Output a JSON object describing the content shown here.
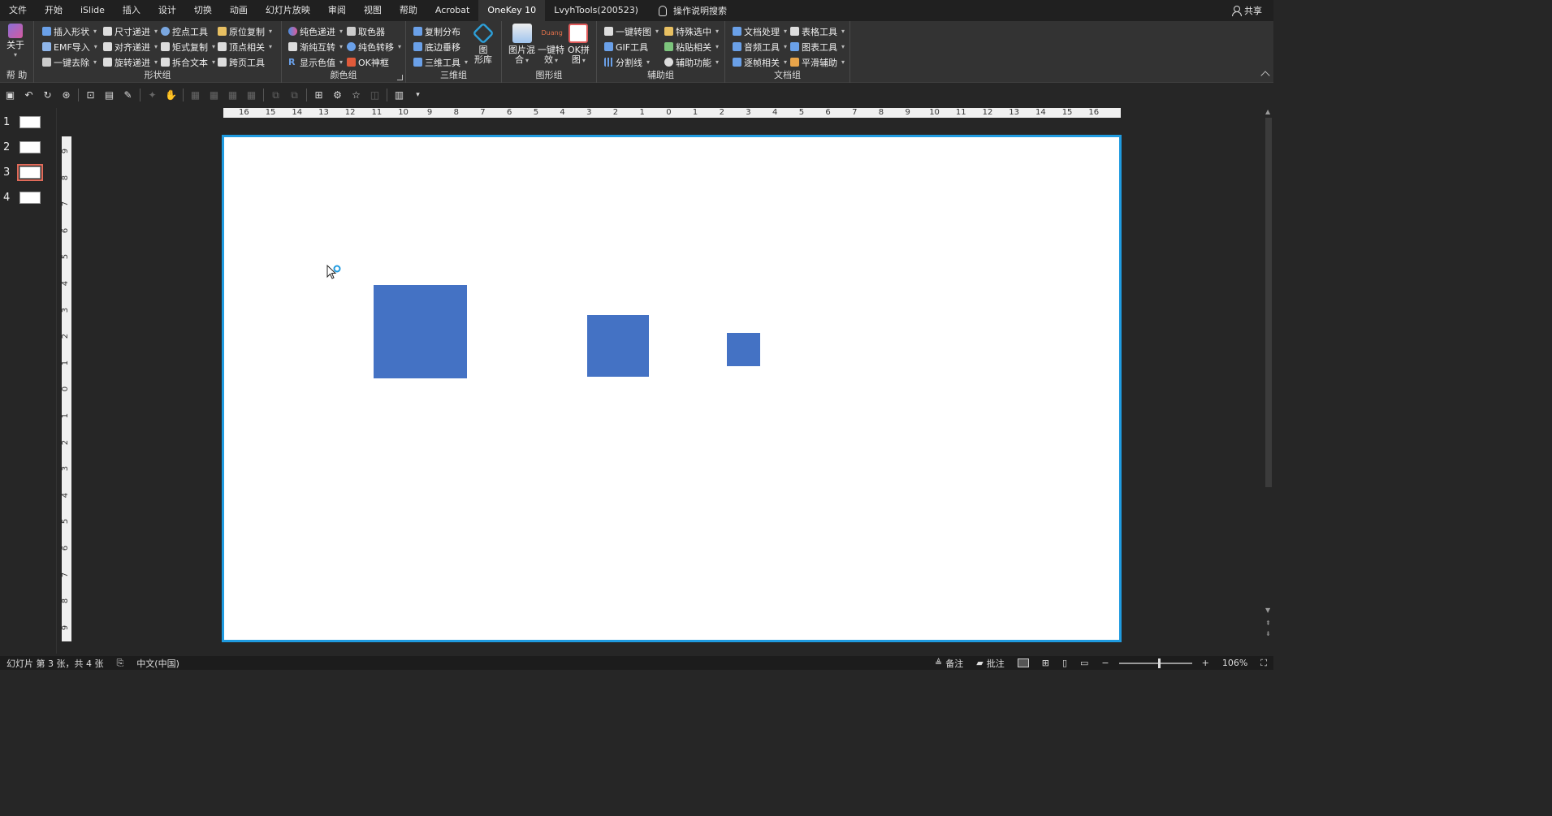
{
  "tabs": [
    "文件",
    "开始",
    "iSlide",
    "插入",
    "设计",
    "切换",
    "动画",
    "幻灯片放映",
    "审阅",
    "视图",
    "帮助",
    "Acrobat",
    "OneKey 10",
    "LvyhTools(200523)"
  ],
  "active_tab_index": 12,
  "tell_me": "操作说明搜索",
  "share": "共享",
  "ribbon": {
    "help_group": {
      "button": "关于",
      "label": "帮 助"
    },
    "shape_group": {
      "label": "形状组",
      "col1": [
        "插入形状",
        "EMF导入",
        "一键去除"
      ],
      "col2": [
        "尺寸递进",
        "对齐递进",
        "旋转递进"
      ],
      "col3": [
        "控点工具",
        "矩式复制",
        "拆合文本"
      ],
      "col4": [
        "原位复制",
        "顶点相关",
        "跨页工具"
      ]
    },
    "color_group": {
      "label": "颜色组",
      "col1": [
        "纯色递进",
        "渐纯互转",
        "显示色值"
      ],
      "col2": [
        "取色器",
        "纯色转移",
        "OK神框"
      ]
    },
    "3d_group": {
      "label": "三维组",
      "col1": [
        "复制分布",
        "底边垂移",
        "三维工具"
      ],
      "big": "图\n形库"
    },
    "graphic_group": {
      "label": "图形组",
      "big1": "图片混\n合",
      "big2": "一键特\n效",
      "big2_sub": "Duang",
      "big3": "OK拼\n图"
    },
    "assist_group": {
      "label": "辅助组",
      "col1": [
        "一键转图",
        "GIF工具",
        "分割线"
      ],
      "col2": [
        "特殊选中",
        "粘贴相关",
        "辅助功能"
      ]
    },
    "doc_group": {
      "label": "文档组",
      "col1": [
        "文档处理",
        "音频工具",
        "逐帧相关"
      ],
      "col2": [
        "表格工具",
        "图表工具",
        "平滑辅助"
      ]
    }
  },
  "ruler": {
    "h_labels": [
      "16",
      "15",
      "14",
      "13",
      "12",
      "11",
      "10",
      "9",
      "8",
      "7",
      "6",
      "5",
      "4",
      "3",
      "2",
      "1",
      "0",
      "1",
      "2",
      "3",
      "4",
      "5",
      "6",
      "7",
      "8",
      "9",
      "10",
      "11",
      "12",
      "13",
      "14",
      "15",
      "16"
    ],
    "v_labels": [
      "9",
      "8",
      "7",
      "6",
      "5",
      "4",
      "3",
      "2",
      "1",
      "0",
      "1",
      "2",
      "3",
      "4",
      "5",
      "6",
      "7",
      "8",
      "9"
    ]
  },
  "slides": [
    {
      "num": "1"
    },
    {
      "num": "2"
    },
    {
      "num": "3"
    },
    {
      "num": "4"
    }
  ],
  "active_slide": 2,
  "shape_color": "#4472c4",
  "status": {
    "slide_info": "幻灯片 第 3 张，共 4 张",
    "language": "中文(中国)",
    "notes": "备注",
    "comments": "批注",
    "zoom": "106%",
    "zoom_minus": "−",
    "zoom_plus": "+"
  }
}
